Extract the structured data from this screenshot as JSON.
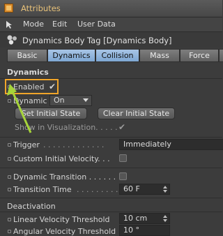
{
  "window": {
    "title": "Attributes"
  },
  "menu": {
    "items": [
      "Mode",
      "Edit",
      "User Data"
    ]
  },
  "object": {
    "title": "Dynamics Body Tag [Dynamics Body]"
  },
  "tabs": [
    {
      "label": "Basic"
    },
    {
      "label": "Dynamics",
      "active": true
    },
    {
      "label": "Collision",
      "active": true
    },
    {
      "label": "Mass"
    },
    {
      "label": "Force"
    },
    {
      "label": "S"
    }
  ],
  "dynamics": {
    "section_title": "Dynamics",
    "enabled_label": "Enabled",
    "enabled_check": "✔",
    "dynamic_label": "Dynamic",
    "dynamic_value": "On",
    "set_initial_state": "Set Initial State",
    "clear_initial_state": "Clear Initial State",
    "show_in_visualization_label": "Show in Visualization. . . . .",
    "show_in_visualization_check": "✔",
    "trigger_label": "Trigger",
    "trigger_dots": ". . . . . . . . . . . . .",
    "trigger_value": "Immediately",
    "custom_initial_velocity_label": "Custom Initial Velocity. . .",
    "dynamic_transition_label": "Dynamic Transition . . . . . .",
    "transition_time_label": "Transition Time",
    "transition_time_dots": ". . . . . . . . .",
    "transition_time_value": "60 F"
  },
  "deactivation": {
    "section_title": "Deactivation",
    "linear_velocity_label": "Linear Velocity Threshold",
    "linear_velocity_value": "10 cm",
    "angular_velocity_label": "Angular Velocity Threshold",
    "angular_velocity_value": "10 °"
  },
  "colors": {
    "highlight": "#f0a52a",
    "arrow": "#a6d43a",
    "tab_active": "#8fb3dc"
  }
}
